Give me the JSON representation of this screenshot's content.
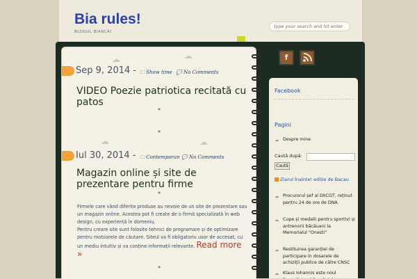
{
  "header": {
    "title": "Bia rules!",
    "description": "BLOGUL BIANCĂI",
    "search_placeholder": "type your search and hit enter"
  },
  "posts": [
    {
      "date": "Sep 9, 2014 -",
      "category": "Show time",
      "comments": "No Comments",
      "title": "VIDEO Poezie patriotica recitată cu patos"
    },
    {
      "date": "Iul 30, 2014 -",
      "category": "Contemporan",
      "comments": "No Comments",
      "title": "Magazin online și site de prezentare pentru firme",
      "excerpt_p1": "Firmele care vând diferite produse au nevoie de un site de prezentare sau un magazin online. Acestea pot fi create de o firmă specializată în web design, cu experiență în domeniu.",
      "excerpt_p2": "Pentru creare site sunt folosite tehnici de programare și de optimizare pentru motoarele de căutare. Siteul va fi obligatoriu usor de accesat, cu un mediu intuitiv și va conține informații relevante.",
      "read_more": "Read more »"
    }
  ],
  "separator": "*",
  "sidebar": {
    "facebook": "Facebook",
    "pages_heading": "Pagini",
    "pages": [
      "Despre mine"
    ],
    "search_label": "Caută după:",
    "search_button": "Caută",
    "feed_title": "Ziarul Înainte! ediție de Bacau",
    "news": [
      "Procurorul șef al DIICOT, reținut pentru 24 de ore de DNA",
      "Cupe și medalii pentru sportivi și antrenorii băcăuani la Memorialul \"Onesti\"",
      "Restituirea garanției de participare in dosarele de achiziții publice de către CNSC",
      "Klaus Iohannis este noul Președinte al României"
    ]
  },
  "colors": {
    "title_blue": "#2a40b0",
    "tag_orange": "#f0a33b",
    "read_more_red": "#c03524",
    "board_dark": "#1d2a22"
  }
}
